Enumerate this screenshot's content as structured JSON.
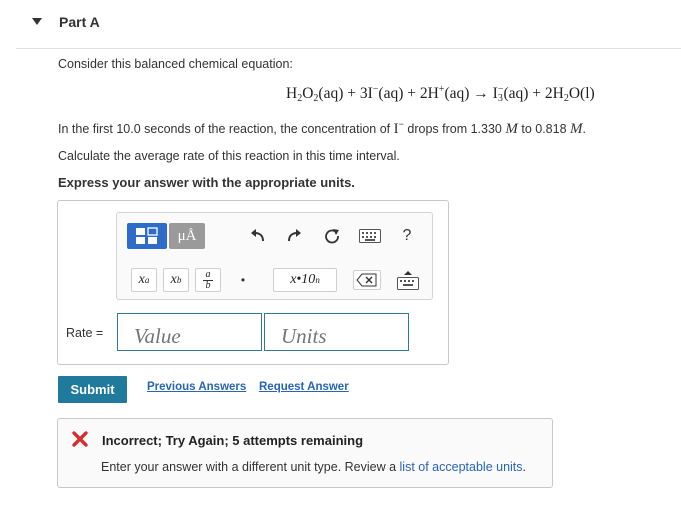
{
  "part": {
    "title": "Part A"
  },
  "question": {
    "intro": "Consider this balanced chemical equation:",
    "equation": {
      "h2o2": "H",
      "h2o2_sub1": "2",
      "h2o2_o": "O",
      "h2o2_sub2": "2",
      "h2o2_state": "(aq)",
      "plus1": " + 3I",
      "i_sup": "−",
      "i_state": "(aq)",
      "plus2": " + 2H",
      "h_sup": "+",
      "h_state": "(aq)",
      "arrow": " → I",
      "i3_sub": "3",
      "i3_sup": "−",
      "i3_state": "(aq)",
      "plus3": " + 2H",
      "h2o_sub": "2",
      "h2o_o": "O",
      "h2o_state": "(l)"
    },
    "line2_a": "In the first 10.0 seconds of the reaction, the concentration of",
    "line2_i": "I",
    "line2_i_sup": "−",
    "line2_b": "drops from 1.330",
    "line2_m1": "M",
    "line2_c": "to 0.818",
    "line2_m2": "M",
    "line2_end": ".",
    "line3": "Calculate the average rate of this reaction in this time interval.",
    "line4": "Express your answer with the appropriate units."
  },
  "toolbar": {
    "mu_label": "μÅ",
    "undo_icon": "undo-icon",
    "redo_icon": "redo-icon",
    "reset_icon": "reset-icon",
    "keyboard_icon": "keyboard-icon",
    "help_label": "?",
    "superscript_x": "x",
    "superscript_a": "a",
    "subscript_x": "x",
    "subscript_b": "b",
    "frac_a": "a",
    "frac_b": "b",
    "dot_label": "•",
    "sci_label": "x•10",
    "sci_sup": "n"
  },
  "answer": {
    "rate_label": "Rate =",
    "value_placeholder": "Value",
    "units_placeholder": "Units"
  },
  "actions": {
    "submit_label": "Submit",
    "previous_answers": "Previous Answers",
    "request_answer": "Request Answer"
  },
  "feedback": {
    "title": "Incorrect; Try Again; 5 attempts remaining",
    "text_before": "Enter your answer with a different unit type. Review a ",
    "link_text": "list of acceptable units",
    "text_after": "."
  },
  "colors": {
    "accent": "#1f7a9c",
    "link": "#2765b8",
    "error": "#d32f2f",
    "toolbar_blue": "#2f6cc7"
  }
}
